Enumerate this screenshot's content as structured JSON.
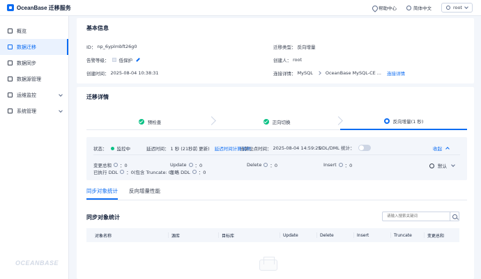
{
  "app": {
    "title": "OceanBase 迁移服务"
  },
  "topbar": {
    "help": "帮助中心",
    "language": "简体中文",
    "user": "root"
  },
  "sidebar": {
    "items": [
      {
        "label": "概览"
      },
      {
        "label": "数据迁移"
      },
      {
        "label": "数据同步"
      },
      {
        "label": "数据源管理"
      },
      {
        "label": "运维监控"
      },
      {
        "label": "系统管理"
      }
    ],
    "footer": "OCEANBASE"
  },
  "basic": {
    "title": "基本信息",
    "id_label": "ID：",
    "id_value": "np_6yplmbft26g0",
    "type_label": "迁移类型：",
    "type_value": "反向增量",
    "alarm_label": "告警等级：",
    "alarm_value": "低保护",
    "creator_label": "创建人：",
    "creator_value": "root",
    "created_label": "创建时间：",
    "created_value": "2025-08-04 10:38:31",
    "conn_label": "连接详情：",
    "conn_source": "MySQL",
    "conn_target": "OceanBase MySQL-CE ...",
    "conn_link": "连接详情"
  },
  "detail": {
    "title": "迁移详情",
    "steps": [
      {
        "label": "预检查"
      },
      {
        "label": "正向切换"
      },
      {
        "label": "反向增量(1 秒)"
      }
    ],
    "status_label": "状态：",
    "status_value": "监控中",
    "delay_label": "延迟时间：",
    "delay_value": "1 秒 (21秒前 更新)",
    "delay_link": "延迟时间计算说明",
    "pos_label": "当前位点时间：",
    "pos_value": "2025-08-04 14:59:25",
    "ddl_label": "DDL/DML 统计：",
    "collapse": "收起",
    "stats": {
      "total_label": "变更总和",
      "total_value": "：0",
      "update_label": "Update",
      "update_value": "：0",
      "delete_label": "Delete",
      "delete_value": "：0",
      "insert_label": "Insert",
      "insert_value": "：0",
      "ddl_exec_label": "已执行 DDL",
      "ddl_exec_value": "：0(包含 Truncate: 0)",
      "ddl_ignore_label": "忽略 DDL",
      "ddl_ignore_value": "：0",
      "default_label": "默认"
    }
  },
  "tabs": [
    {
      "label": "同步对象统计"
    },
    {
      "label": "反向增量性能"
    }
  ],
  "objects": {
    "title": "同步对象统计",
    "search_placeholder": "请输入搜索关键词",
    "columns": [
      "对象名称",
      "源库",
      "目标库",
      "Update",
      "Delete",
      "Insert",
      "Truncate",
      "变更总和"
    ]
  },
  "colors": {
    "accent": "#0c6cf2",
    "success": "#0ac185"
  }
}
